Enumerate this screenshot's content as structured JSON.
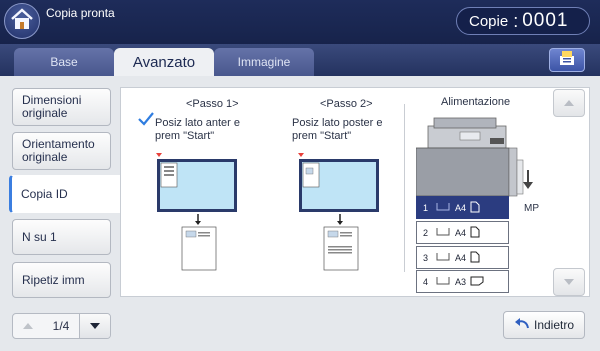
{
  "header": {
    "title": "Copia pronta",
    "copies_label": "Copie",
    "copies_value": "0001"
  },
  "tabs": [
    {
      "label": "Base"
    },
    {
      "label": "Avanzato"
    },
    {
      "label": "Immagine"
    }
  ],
  "sidebar": {
    "items": [
      {
        "label": "Dimensioni originale"
      },
      {
        "label": "Orientamento originale"
      },
      {
        "label": "Copia ID"
      },
      {
        "label": "N su 1"
      },
      {
        "label": "Ripetiz imm"
      }
    ],
    "pager": "1/4"
  },
  "panel": {
    "step1_title": "<Passo 1>",
    "step1_text": "Posiz lato anter e prem \"Start\"",
    "step2_title": "<Passo 2>",
    "step2_text": "Posiz lato poster e prem \"Start\"",
    "feed_title": "Alimentazione",
    "mp_label": "MP",
    "trays": [
      {
        "num": "1",
        "size": "A4"
      },
      {
        "num": "2",
        "size": "A4"
      },
      {
        "num": "3",
        "size": "A4"
      },
      {
        "num": "4",
        "size": "A3"
      }
    ]
  },
  "footer": {
    "back_label": "Indietro"
  }
}
